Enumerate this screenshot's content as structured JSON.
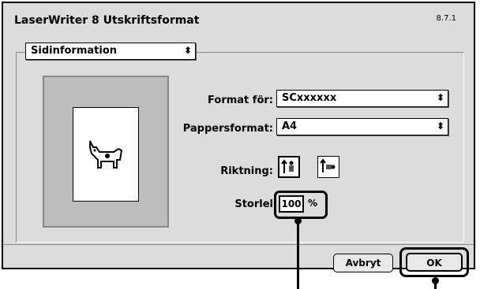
{
  "window": {
    "title": "LaserWriter 8 Utskriftsformat",
    "version": "8.7.1"
  },
  "section_popup": {
    "value": "Sidinformation"
  },
  "format_for": {
    "label": "Format för:",
    "value": "SCxxxxxx"
  },
  "paper_size": {
    "label": "Pappersformat:",
    "value": "A4"
  },
  "orientation": {
    "label": "Riktning:"
  },
  "scale": {
    "label": "Storlel",
    "value": "100",
    "unit": "%"
  },
  "buttons": {
    "cancel": "Avbryt",
    "ok": "OK"
  },
  "icons": {
    "popup_arrows": "updown-arrows-icon",
    "preview": "dogcow-icon",
    "portrait": "portrait-orientation-icon",
    "landscape": "landscape-orientation-icon"
  }
}
